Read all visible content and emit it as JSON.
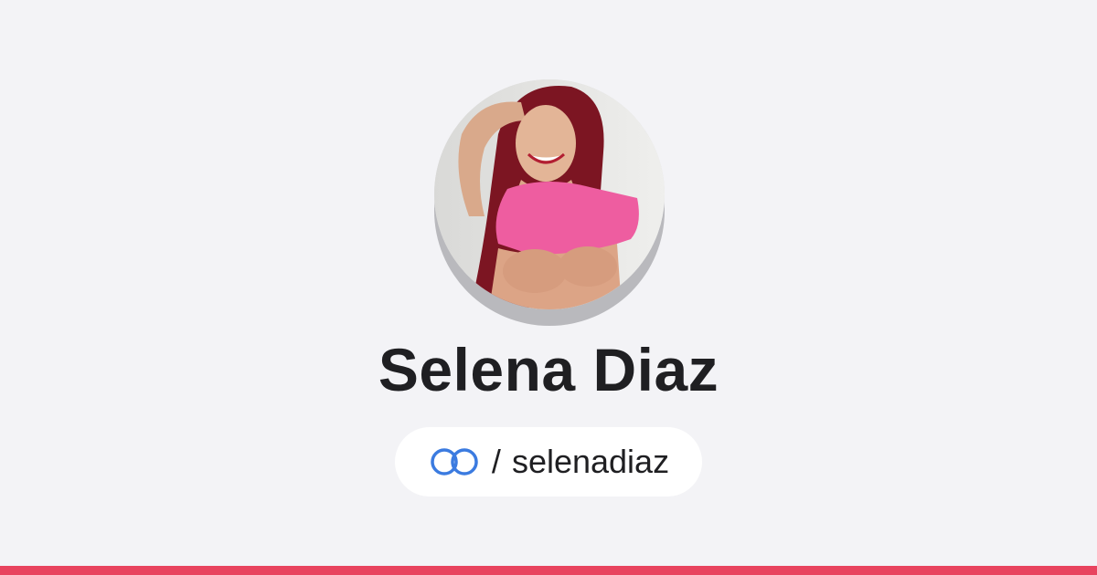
{
  "profile": {
    "name": "Selena Diaz",
    "handle_prefix": "/",
    "handle": "selenadiaz",
    "avatar_alt": "profile photo"
  },
  "icons": {
    "link": "link-rings-icon"
  },
  "colors": {
    "background": "#f3f3f6",
    "accent_bar": "#e8435e",
    "link_icon": "#3b7be0",
    "text": "#1f1f22"
  }
}
